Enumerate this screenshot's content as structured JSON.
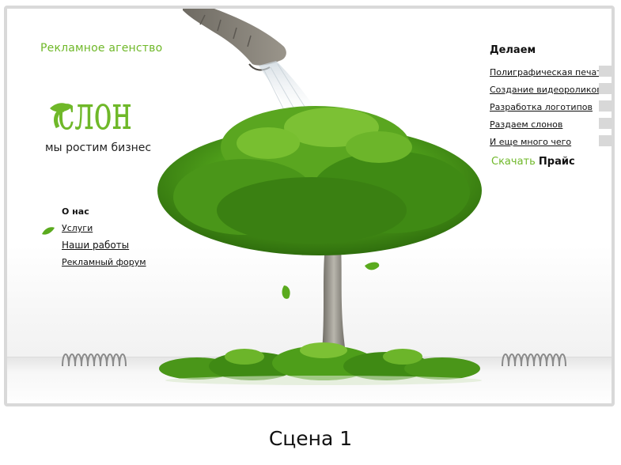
{
  "header": {
    "agency": "Рекламное агенство",
    "logo_text": "слон",
    "tagline": "мы ростим бизнес"
  },
  "nav": {
    "items": [
      {
        "label": "О нас"
      },
      {
        "label": "Услуги"
      },
      {
        "label": "Наши работы"
      },
      {
        "label": "Рекламный форум"
      }
    ]
  },
  "services": {
    "title": "Делаем",
    "items": [
      {
        "label": "Полиграфическая печать"
      },
      {
        "label": "Создание видеороликов"
      },
      {
        "label": "Разработка логотипов"
      },
      {
        "label": "Раздаем слонов"
      },
      {
        "label": "И еще много чего"
      }
    ]
  },
  "price": {
    "download": "Скачать",
    "price": "Прайс"
  },
  "caption": "Сцена 1",
  "colors": {
    "accent": "#6fb829",
    "leaf_dark": "#3e8a12",
    "trunk": "#8c8a80",
    "frame": "#d9d9d9"
  },
  "icons": {
    "leaf": "leaf-icon",
    "trunk": "elephant-trunk-icon",
    "spring": "spring-icon"
  }
}
